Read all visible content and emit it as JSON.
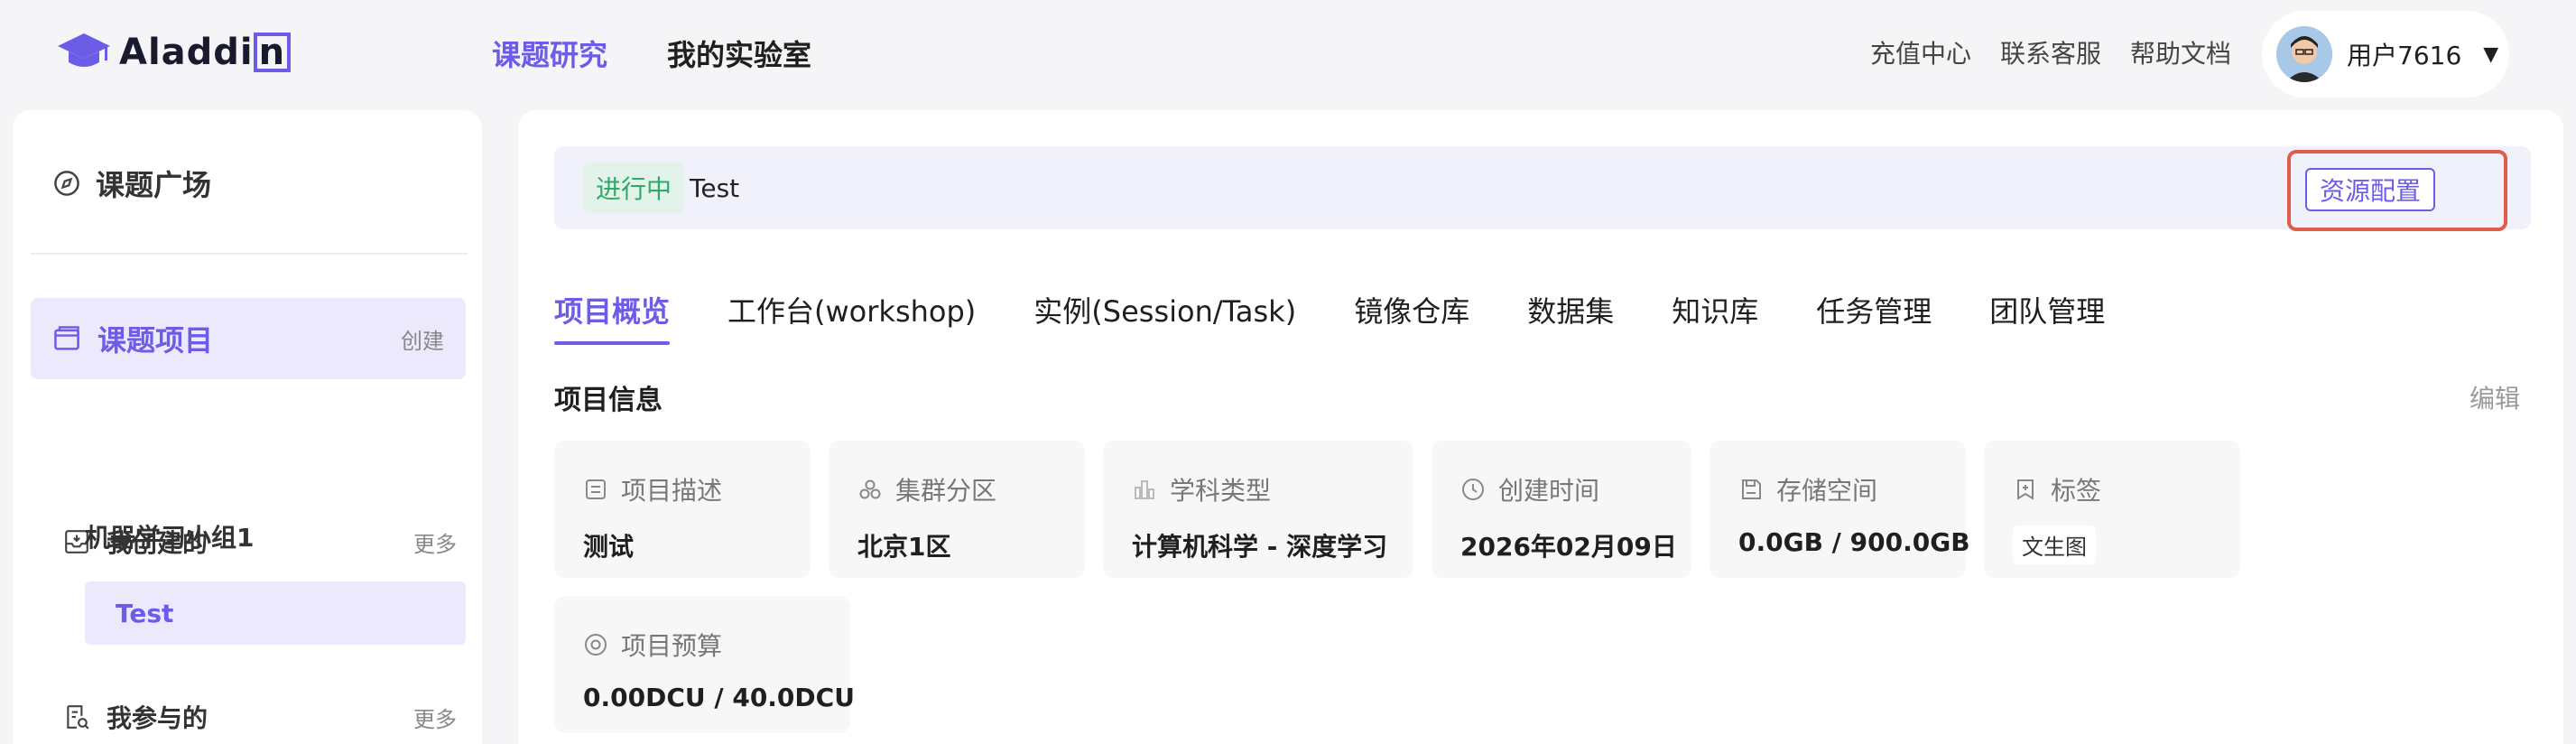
{
  "header": {
    "logo_text_a": "Aladdi",
    "logo_text_b": "n",
    "nav": [
      {
        "label": "课题研究"
      },
      {
        "label": "我的实验室"
      }
    ],
    "links": [
      {
        "label": "充值中心"
      },
      {
        "label": "联系客服"
      },
      {
        "label": "帮助文档"
      }
    ],
    "user": {
      "name": "用户7616"
    }
  },
  "sidebar": {
    "plaza": "课题广场",
    "project": {
      "label": "课题项目",
      "action": "创建"
    },
    "created": {
      "label": "我创建的",
      "more": "更多"
    },
    "created_items": [
      "机器学习小组1",
      "Test"
    ],
    "joined": {
      "label": "我参与的",
      "more": "更多"
    }
  },
  "main": {
    "status": "进行中",
    "project_name": "Test",
    "resource_button": "资源配置",
    "tabs": [
      {
        "label": "项目概览"
      },
      {
        "label": "工作台(workshop)"
      },
      {
        "label": "实例(Session/Task)"
      },
      {
        "label": "镜像仓库"
      },
      {
        "label": "数据集"
      },
      {
        "label": "知识库"
      },
      {
        "label": "任务管理"
      },
      {
        "label": "团队管理"
      }
    ],
    "section_title": "项目信息",
    "edit": "编辑",
    "cards": [
      {
        "label": "项目描述",
        "value": "测试",
        "icon": "description-icon"
      },
      {
        "label": "集群分区",
        "value": "北京1区",
        "icon": "cluster-icon"
      },
      {
        "label": "学科类型",
        "value": "计算机科学 - 深度学习",
        "icon": "subject-icon"
      },
      {
        "label": "创建时间",
        "value": "2026年02月09日",
        "icon": "clock-icon"
      },
      {
        "label": "存储空间",
        "value": "0.0GB / 900.0GB",
        "icon": "storage-icon"
      },
      {
        "label": "标签",
        "value": "文生图",
        "icon": "tag-icon"
      },
      {
        "label": "项目预算",
        "value": "0.00DCU / 40.0DCU",
        "icon": "budget-icon"
      }
    ]
  },
  "colors": {
    "accent": "#6c5ce7",
    "status_green": "#2eaa6a",
    "highlight_red": "#e25c4b"
  }
}
